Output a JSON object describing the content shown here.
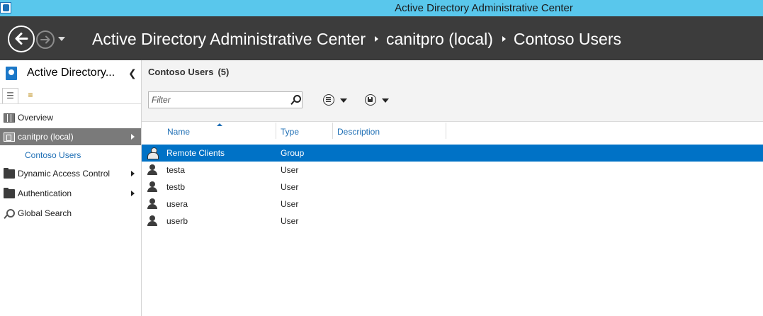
{
  "window": {
    "title": "Active Directory Administrative Center"
  },
  "header": {
    "breadcrumbs": [
      "Active Directory Administrative Center",
      "canitpro (local)",
      "Contoso Users"
    ]
  },
  "leftnav": {
    "title": "Active Directory...",
    "items": [
      {
        "label": "Overview",
        "icon": "overview-grid-icon",
        "selected": false,
        "has_arrow": false
      },
      {
        "label": "canitpro (local)",
        "icon": "domain-icon",
        "selected": true,
        "has_arrow": true
      },
      {
        "label": "Contoso Users",
        "icon": "",
        "selected": false,
        "has_arrow": false
      },
      {
        "label": "Dynamic Access Control",
        "icon": "folder-icon",
        "selected": false,
        "has_arrow": true
      },
      {
        "label": "Authentication",
        "icon": "folder-icon",
        "selected": false,
        "has_arrow": true
      },
      {
        "label": "Global Search",
        "icon": "search-icon",
        "selected": false,
        "has_arrow": false
      }
    ]
  },
  "main": {
    "title": "Contoso Users",
    "count": "(5)",
    "filter": {
      "placeholder": "Filter",
      "value": ""
    },
    "columns": [
      "Name",
      "Type",
      "Description"
    ],
    "rows": [
      {
        "name": "Remote Clients",
        "type": "Group",
        "description": "",
        "icon": "group-icon",
        "selected": true
      },
      {
        "name": "testa",
        "type": "User",
        "description": "",
        "icon": "user-icon",
        "selected": false
      },
      {
        "name": "testb",
        "type": "User",
        "description": "",
        "icon": "user-icon",
        "selected": false
      },
      {
        "name": "usera",
        "type": "User",
        "description": "",
        "icon": "user-icon",
        "selected": false
      },
      {
        "name": "userb",
        "type": "User",
        "description": "",
        "icon": "user-icon",
        "selected": false
      }
    ]
  },
  "colors": {
    "titlebar": "#59c7ec",
    "header": "#3c3c3c",
    "selection": "#0072c6",
    "link": "#1f6fb5"
  }
}
